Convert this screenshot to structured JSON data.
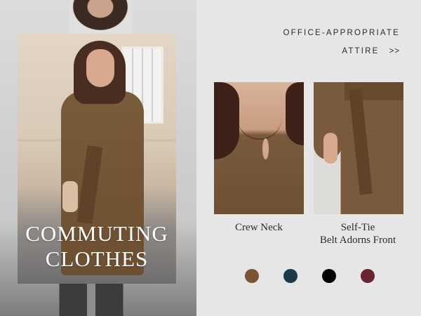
{
  "headline": {
    "line1": "COMMUTING",
    "line2": "CLOTHES"
  },
  "kicker": {
    "line1": "OFFICE-APPROPRIATE",
    "line2": "ATTIRE",
    "arrows": ">>"
  },
  "features": [
    {
      "caption_line1": "Crew Neck",
      "caption_line2": ""
    },
    {
      "caption_line1": "Self-Tie",
      "caption_line2": "Belt Adorns Front"
    }
  ],
  "colors": [
    {
      "name": "brown",
      "hex": "#7b5533"
    },
    {
      "name": "navy",
      "hex": "#1d3a48"
    },
    {
      "name": "black",
      "hex": "#050505"
    },
    {
      "name": "burgundy",
      "hex": "#6a2430"
    }
  ]
}
